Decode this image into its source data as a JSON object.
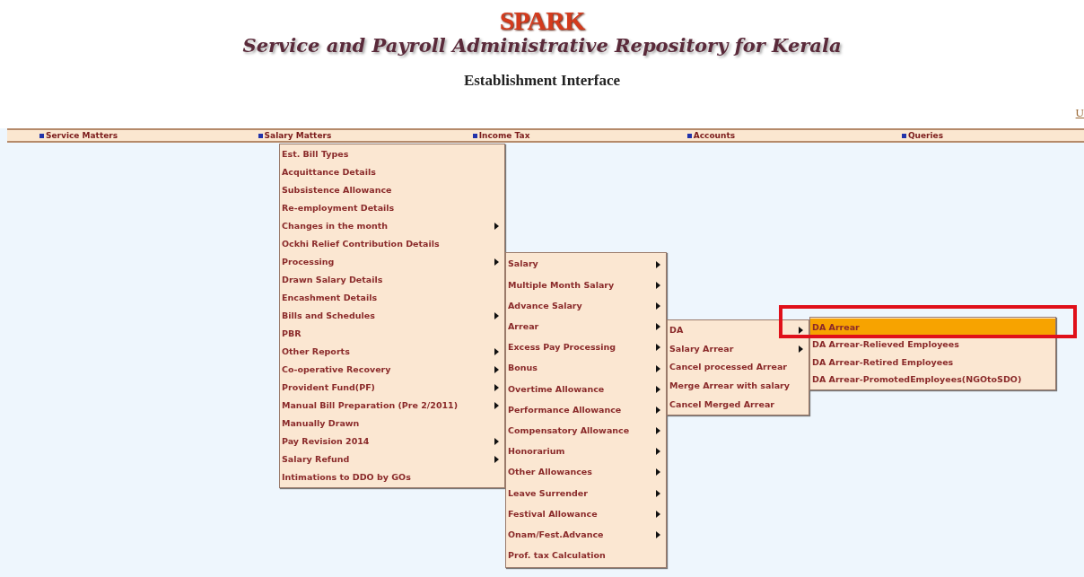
{
  "header": {
    "logo": "SPARK",
    "title": "Service and Payroll Administrative Repository for Kerala",
    "subtitle": "Establishment Interface",
    "corner_link": "U"
  },
  "menubar": [
    {
      "label": "Service Matters"
    },
    {
      "label": "Salary Matters"
    },
    {
      "label": "Income Tax"
    },
    {
      "label": "Accounts"
    },
    {
      "label": "Queries"
    }
  ],
  "menus": [
    {
      "items": [
        {
          "label": "Est. Bill Types",
          "submenu": false,
          "selected": false
        },
        {
          "label": "Acquittance Details",
          "submenu": false,
          "selected": false
        },
        {
          "label": "Subsistence Allowance",
          "submenu": false,
          "selected": false
        },
        {
          "label": "Re-employment Details",
          "submenu": false,
          "selected": false
        },
        {
          "label": "Changes in the month",
          "submenu": true,
          "selected": false
        },
        {
          "label": "Ockhi Relief Contribution Details",
          "submenu": false,
          "selected": false
        },
        {
          "label": "Processing",
          "submenu": true,
          "selected": false
        },
        {
          "label": "Drawn Salary Details",
          "submenu": false,
          "selected": false
        },
        {
          "label": "Encashment Details",
          "submenu": false,
          "selected": false
        },
        {
          "label": "Bills and Schedules",
          "submenu": true,
          "selected": false
        },
        {
          "label": "PBR",
          "submenu": false,
          "selected": false
        },
        {
          "label": "Other Reports",
          "submenu": true,
          "selected": false
        },
        {
          "label": "Co-operative Recovery",
          "submenu": true,
          "selected": false
        },
        {
          "label": "Provident Fund(PF)",
          "submenu": true,
          "selected": false
        },
        {
          "label": "Manual Bill Preparation (Pre 2/2011)",
          "submenu": true,
          "selected": false
        },
        {
          "label": "Manually Drawn",
          "submenu": false,
          "selected": false
        },
        {
          "label": "Pay Revision 2014",
          "submenu": true,
          "selected": false
        },
        {
          "label": "Salary Refund",
          "submenu": true,
          "selected": false
        },
        {
          "label": "Intimations to DDO by GOs",
          "submenu": false,
          "selected": false
        }
      ]
    },
    {
      "items": [
        {
          "label": "Salary",
          "submenu": true,
          "selected": false
        },
        {
          "label": "Multiple Month Salary",
          "submenu": true,
          "selected": false
        },
        {
          "label": "Advance Salary",
          "submenu": true,
          "selected": false
        },
        {
          "label": "Arrear",
          "submenu": true,
          "selected": false
        },
        {
          "label": "Excess Pay Processing",
          "submenu": true,
          "selected": false
        },
        {
          "label": "Bonus",
          "submenu": true,
          "selected": false
        },
        {
          "label": "Overtime Allowance",
          "submenu": true,
          "selected": false
        },
        {
          "label": "Performance Allowance",
          "submenu": true,
          "selected": false
        },
        {
          "label": "Compensatory Allowance",
          "submenu": true,
          "selected": false
        },
        {
          "label": "Honorarium",
          "submenu": true,
          "selected": false
        },
        {
          "label": "Other Allowances",
          "submenu": true,
          "selected": false
        },
        {
          "label": "Leave Surrender",
          "submenu": true,
          "selected": false
        },
        {
          "label": "Festival Allowance",
          "submenu": true,
          "selected": false
        },
        {
          "label": "Onam/Fest.Advance",
          "submenu": true,
          "selected": false
        },
        {
          "label": "Prof. tax Calculation",
          "submenu": false,
          "selected": false
        }
      ]
    },
    {
      "items": [
        {
          "label": "DA",
          "submenu": true,
          "selected": false
        },
        {
          "label": "Salary Arrear",
          "submenu": true,
          "selected": false
        },
        {
          "label": "Cancel processed Arrear",
          "submenu": false,
          "selected": false
        },
        {
          "label": "Merge Arrear with salary",
          "submenu": false,
          "selected": false
        },
        {
          "label": "Cancel Merged Arrear",
          "submenu": false,
          "selected": false
        }
      ]
    },
    {
      "items": [
        {
          "label": "DA Arrear",
          "submenu": false,
          "selected": true
        },
        {
          "label": "DA Arrear-Relieved Employees",
          "submenu": false,
          "selected": false
        },
        {
          "label": "DA Arrear-Retired Employees",
          "submenu": false,
          "selected": false
        },
        {
          "label": "DA Arrear-PromotedEmployees(NGOtoSDO)",
          "submenu": false,
          "selected": false
        }
      ]
    }
  ]
}
